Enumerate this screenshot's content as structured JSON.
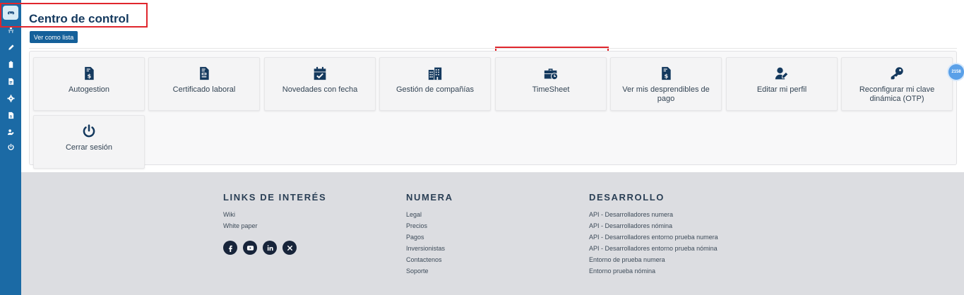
{
  "header": {
    "title": "Centro de control",
    "view_list_button": "Ver como lista"
  },
  "sidebar": {
    "items": [
      {
        "icon": "gamepad-icon",
        "active": true
      },
      {
        "icon": "user-desk-icon"
      },
      {
        "icon": "pen-icon"
      },
      {
        "icon": "clipboard-icon"
      },
      {
        "icon": "document-icon"
      },
      {
        "icon": "gear-icon"
      },
      {
        "icon": "invoice-icon"
      },
      {
        "icon": "user-edit-icon"
      },
      {
        "icon": "power-icon"
      }
    ]
  },
  "cards": [
    {
      "label": "Autogestion",
      "icon": "invoice-dollar-icon"
    },
    {
      "label": "Certificado laboral",
      "icon": "file-form-icon"
    },
    {
      "label": "Novedades con fecha",
      "icon": "calendar-check-icon"
    },
    {
      "label": "Gestión de compañías",
      "icon": "buildings-icon"
    },
    {
      "label": "TimeSheet",
      "icon": "briefcase-clock-icon"
    },
    {
      "label": "Ver mis desprendibles de pago",
      "icon": "invoice-dollar-icon"
    },
    {
      "label": "Editar mi perfil",
      "icon": "user-edit-icon"
    },
    {
      "label": "Reconfigurar mi clave dinámica (OTP)",
      "icon": "key-icon"
    },
    {
      "label": "Cerrar sesión",
      "icon": "power-icon"
    }
  ],
  "notification_bubble": "2158",
  "footer": {
    "col1": {
      "title": "LINKS DE INTERÉS",
      "links": [
        "Wiki",
        "White paper"
      ],
      "social": [
        "facebook-icon",
        "youtube-icon",
        "linkedin-icon",
        "x-icon"
      ]
    },
    "col2": {
      "title": "NUMERA",
      "links": [
        "Legal",
        "Precios",
        "Pagos",
        "Inversionistas",
        "Contactenos",
        "Soporte"
      ]
    },
    "col3": {
      "title": "DESARROLLO",
      "links": [
        "API - Desarrolladores numera",
        "API - Desarrolladores nómina",
        "API - Desarrolladores entorno prueba numera",
        "API - Desarrolladores entorno prueba nómina",
        "Entorno de prueba numera",
        "Entorno prueba nómina"
      ]
    }
  },
  "colors": {
    "sidebar": "#1b6aa5",
    "title": "#14395e",
    "icon": "#14395e",
    "highlight": "#e0262d",
    "footer_bg": "#dcdde1"
  }
}
